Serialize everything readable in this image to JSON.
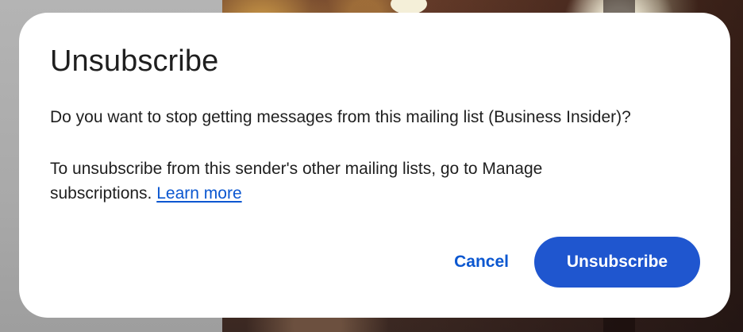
{
  "dialog": {
    "title": "Unsubscribe",
    "message": "Do you want to stop getting messages from this mailing list (Business Insider)?",
    "detail": "To unsubscribe from this sender's other mailing lists, go to Manage subscriptions.",
    "learn_more_label": "Learn more",
    "cancel_label": "Cancel",
    "confirm_label": "Unsubscribe"
  },
  "colors": {
    "accent": "#0b57d0",
    "primary_button": "#1f56cf",
    "text": "#1f1f1f",
    "surface": "#ffffff"
  }
}
